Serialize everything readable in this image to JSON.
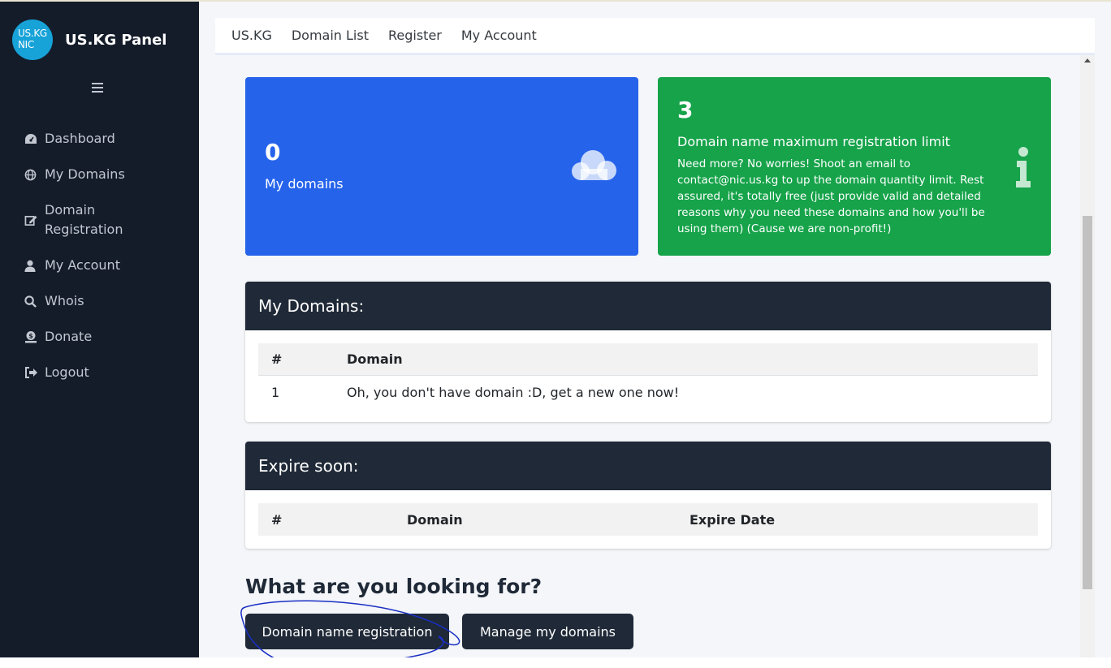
{
  "brand": {
    "logo_line1": "US.KG",
    "logo_line2": "NIC",
    "name": "US.KG Panel"
  },
  "sidebar": {
    "toggle_icon": "hamburger-icon",
    "items": [
      {
        "label": "Dashboard",
        "icon": "tachometer-icon"
      },
      {
        "label": "My Domains",
        "icon": "globe-icon"
      },
      {
        "label": "Domain\nRegistration",
        "icon": "edit-icon"
      },
      {
        "label": "My Account",
        "icon": "user-icon"
      },
      {
        "label": "Whois",
        "icon": "search-icon"
      },
      {
        "label": "Donate",
        "icon": "donate-icon"
      },
      {
        "label": "Logout",
        "icon": "sign-out-icon"
      }
    ]
  },
  "topnav": {
    "items": [
      "US.KG",
      "Domain List",
      "Register",
      "My Account"
    ]
  },
  "stats": {
    "domains_count": "0",
    "domains_label": "My domains",
    "limit_count": "3",
    "limit_title": "Domain name maximum registration limit",
    "limit_desc": "Need more? No worries! Shoot an email to contact@nic.us.kg to up the domain quantity limit. Rest assured, it's totally free (just provide valid and detailed reasons why you need these domains and how you'll be using them) (Cause we are non-profit!)"
  },
  "my_domains": {
    "title": "My Domains:",
    "columns": [
      "#",
      "Domain"
    ],
    "rows": [
      [
        "1",
        "Oh, you don't have domain :D, get a new one now!"
      ]
    ]
  },
  "expire_soon": {
    "title": "Expire soon:",
    "columns": [
      "#",
      "Domain",
      "Expire Date"
    ]
  },
  "actions": {
    "heading": "What are you looking for?",
    "register_button": "Domain name registration",
    "manage_button": "Manage my domains"
  },
  "colors": {
    "sidebar_bg": "#141c2a",
    "card_blue": "#2563eb",
    "card_green": "#16a34a",
    "dark": "#1f2937",
    "annotation_stroke": "#1a2fc4"
  }
}
